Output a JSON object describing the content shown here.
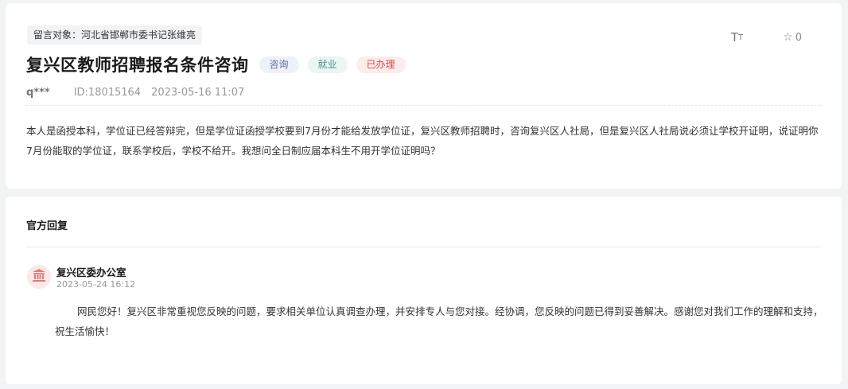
{
  "post": {
    "target_label": "留言对象：河北省邯郸市委书记张维亮",
    "title": "复兴区教师招聘报名条件咨询",
    "tags": [
      "咨询",
      "就业",
      "已办理"
    ],
    "user": "q***",
    "id": "ID:18015164",
    "time": "2023-05-16 11:07",
    "content": "本人是函授本科，学位证已经答辩完，但是学位证函授学校要到7月份才能给发放学位证，复兴区教师招聘时，咨询复兴区人社局，但是复兴区人社局说必须让学校开证明，说证明你7月份能取的学位证，联系学校后，学校不给开。我想问全日制应届本科生不用开学位证明吗？",
    "font_tool_label_big": "T",
    "font_tool_label_small": "T",
    "star_count": "0"
  },
  "reply": {
    "section_title": "官方回复",
    "org": "复兴区委办公室",
    "time": "2023-05-24 16:12",
    "content": "网民您好！复兴区非常重视您反映的问题，要求相关单位认真调查办理，并安排专人与您对接。经协调，您反映的问题已得到妥善解决。感谢您对我们工作的理解和支持，祝生活愉快！"
  },
  "icons": {
    "font_size": "font-size-icon",
    "star": "star-icon",
    "avatar": "government-building-icon"
  },
  "colors": {
    "tag_consult": "#5a6f99",
    "tag_employ": "#4d8f86",
    "tag_done": "#d2484b",
    "avatar_icon": "#e07a7a"
  }
}
